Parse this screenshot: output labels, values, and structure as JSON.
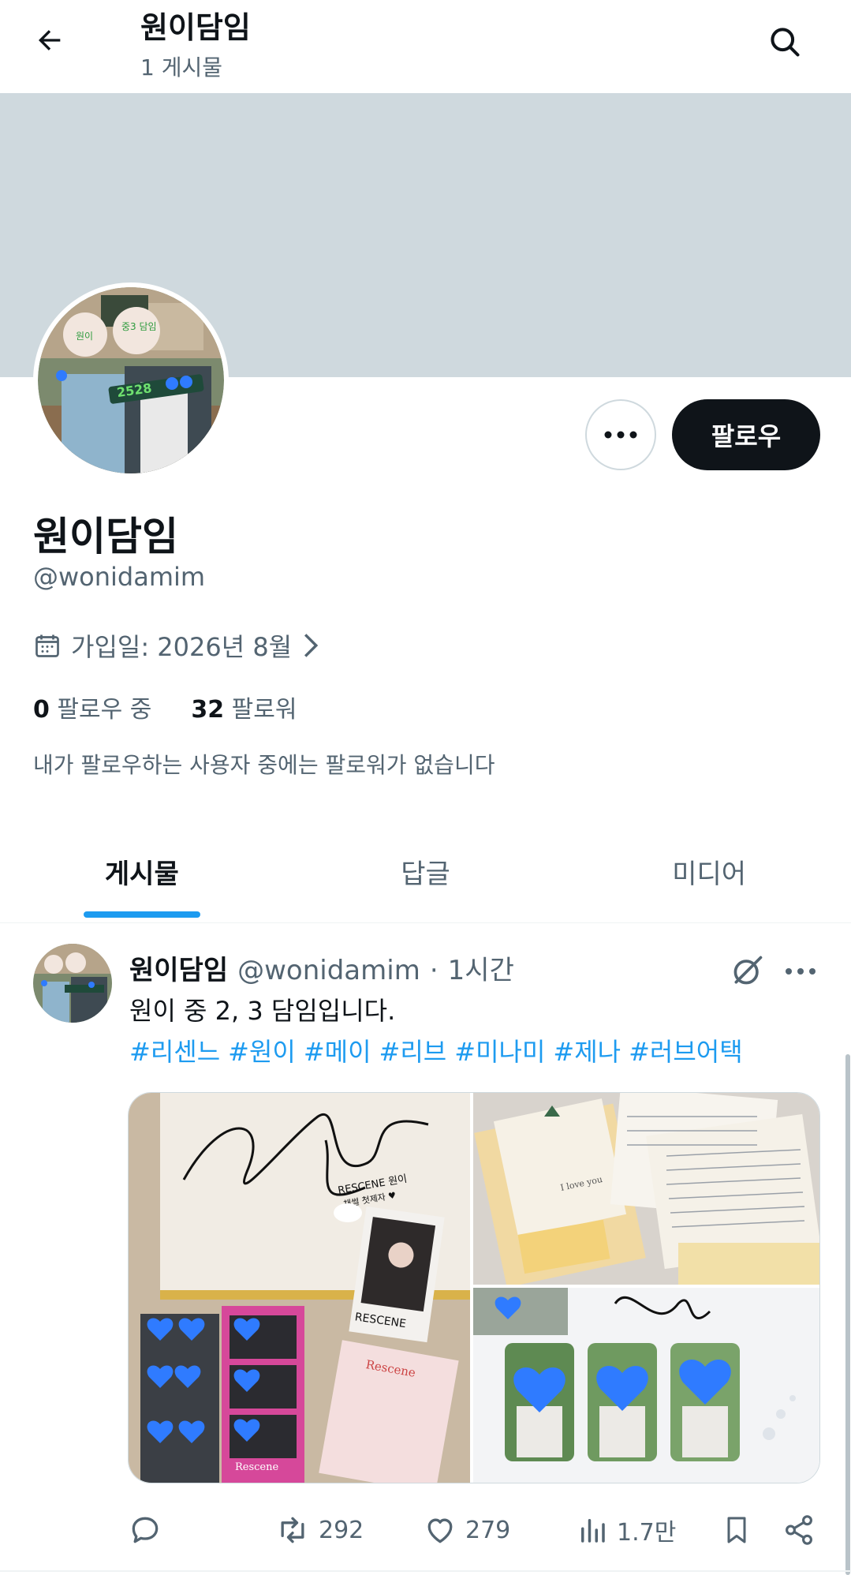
{
  "header": {
    "title": "원이담임",
    "post_count": "1 게시물"
  },
  "profile": {
    "display_name": "원이담임",
    "handle": "@wonidamim",
    "joined": "가입일: 2026년 8월",
    "following_count": "0",
    "following_label": "팔로우 중",
    "followers_count": "32",
    "followers_label": "팔로워",
    "followers_note": "내가 팔로우하는 사용자 중에는 팔로워가 없습니다",
    "follow_button": "팔로우",
    "avatar_tags": [
      "원이",
      "중3 담임",
      "2528"
    ]
  },
  "tabs": [
    {
      "label": "게시물",
      "active": true
    },
    {
      "label": "답글",
      "active": false
    },
    {
      "label": "미디어",
      "active": false
    }
  ],
  "post": {
    "name": "원이담임",
    "handle": "@wonidamim",
    "dot": "·",
    "time": "1시간",
    "text": "원이 중 2, 3 담임입니다.",
    "hashtags": [
      "#리센느",
      "#원이",
      "#메이",
      "#리브",
      "#미나미",
      "#제나",
      "#러브어택"
    ],
    "media_text": {
      "signature_note_1": "RESCENE 원이",
      "signature_note_2": "채썰 첫제자 ♥",
      "photocard_label": "RESCENE",
      "card_brand": "Rescene",
      "sticker_brand": "Rescene",
      "letter_note": "I love you"
    },
    "stats": {
      "retweets": "292",
      "likes": "279",
      "views": "1.7만"
    }
  },
  "colors": {
    "accent": "#1d9bf0",
    "text_primary": "#0f1419",
    "text_secondary": "#536471",
    "banner": "#cfd9de",
    "heart_blue": "#2f7bff"
  }
}
